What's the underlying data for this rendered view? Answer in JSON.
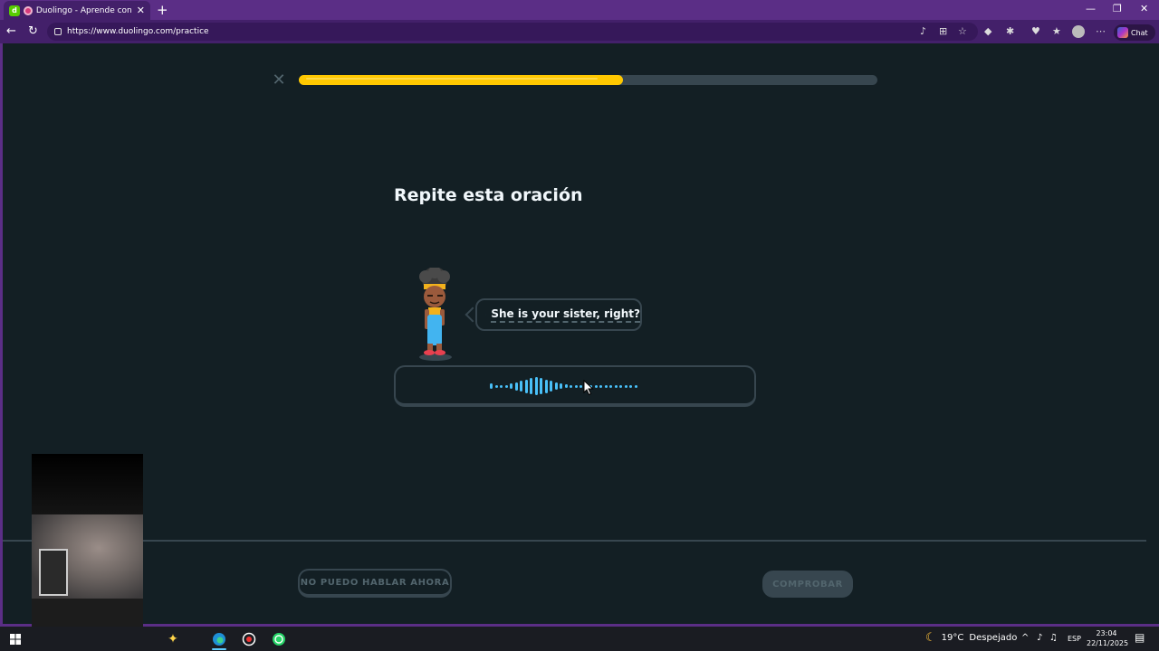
{
  "browser": {
    "tab_title": "Duolingo - Aprende con lec",
    "url": "https://www.duolingo.com/practice",
    "chat_label": "Chat"
  },
  "lesson": {
    "progress_percent": 56,
    "prompt": "Repite esta oración",
    "sentence": "She is your sister, right?",
    "skip_button": "NO PUEDO HABLAR AHORA",
    "check_button": "COMPROBAR",
    "accent_color": "#ffc800",
    "wave_color": "#49c0f8"
  },
  "taskbar": {
    "weather_temp": "19°C",
    "weather_desc": "Despejado",
    "language": "ESP",
    "time": "23:04",
    "date": "22/11/2025"
  }
}
